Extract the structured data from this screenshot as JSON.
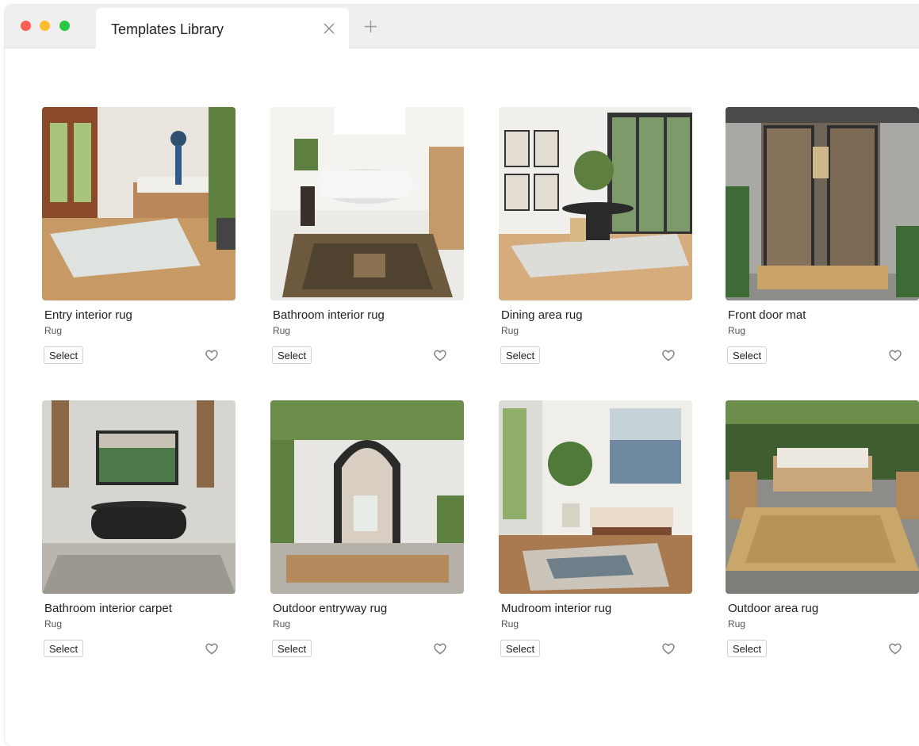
{
  "window": {
    "tab_title": "Templates Library"
  },
  "icons": {
    "close": "close-icon",
    "new_tab": "plus-icon",
    "favorite": "heart-icon"
  },
  "colors": {
    "traffic_red": "#fe5f57",
    "traffic_yellow": "#febc2e",
    "traffic_green": "#28c840"
  },
  "templates": [
    {
      "title": "Entry interior rug",
      "category": "Rug",
      "select_label": "Select"
    },
    {
      "title": "Bathroom interior rug",
      "category": "Rug",
      "select_label": "Select"
    },
    {
      "title": "Dining area rug",
      "category": "Rug",
      "select_label": "Select"
    },
    {
      "title": "Front door mat",
      "category": "Rug",
      "select_label": "Select"
    },
    {
      "title": "Bathroom interior carpet",
      "category": "Rug",
      "select_label": "Select"
    },
    {
      "title": "Outdoor entryway rug",
      "category": "Rug",
      "select_label": "Select"
    },
    {
      "title": "Mudroom interior rug",
      "category": "Rug",
      "select_label": "Select"
    },
    {
      "title": "Outdoor area rug",
      "category": "Rug",
      "select_label": "Select"
    }
  ]
}
